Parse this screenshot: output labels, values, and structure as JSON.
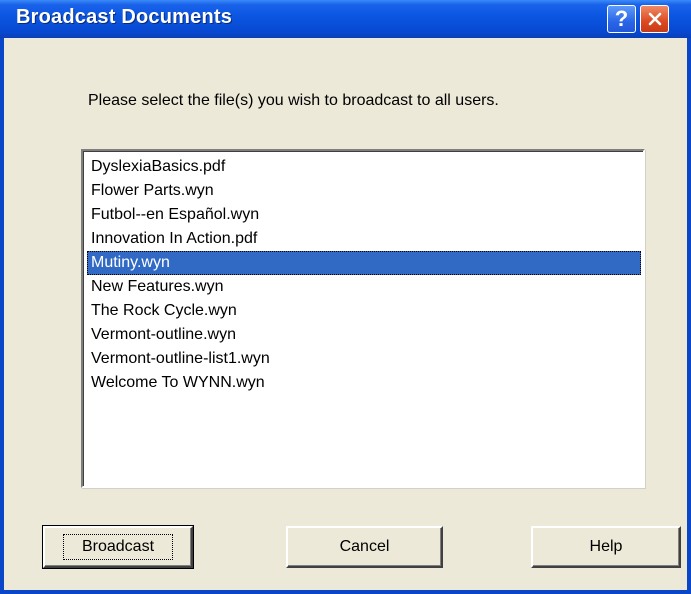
{
  "window": {
    "title": "Broadcast Documents"
  },
  "titlebar_buttons": {
    "help_label": "?"
  },
  "prompt": "Please select the file(s) you wish to broadcast to all users.",
  "files": [
    "DyslexiaBasics.pdf",
    "Flower Parts.wyn",
    "Futbol--en Español.wyn",
    "Innovation In Action.pdf",
    "Mutiny.wyn",
    "New Features.wyn",
    "The Rock Cycle.wyn",
    "Vermont-outline.wyn",
    "Vermont-outline-list1.wyn",
    "Welcome To WYNN.wyn"
  ],
  "selected_file": "Mutiny.wyn",
  "buttons": {
    "broadcast": "Broadcast",
    "cancel": "Cancel",
    "help": "Help"
  },
  "colors": {
    "titlebar": "#0a55e0",
    "selection": "#316ac5",
    "dialog_face": "#ece9d8"
  }
}
